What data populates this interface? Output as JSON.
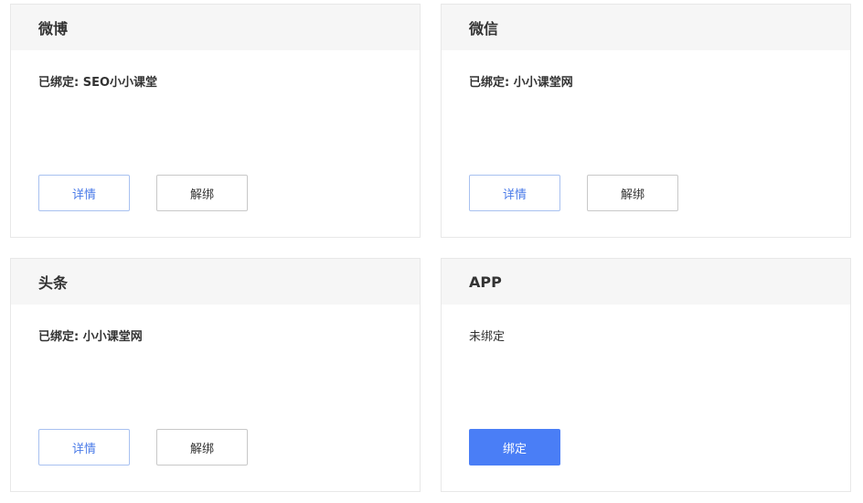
{
  "cards": [
    {
      "title": "微博",
      "status": "已绑定: SEO小小课堂",
      "detail_label": "详情",
      "unbind_label": "解绑"
    },
    {
      "title": "微信",
      "status": "已绑定: 小小课堂网",
      "detail_label": "详情",
      "unbind_label": "解绑"
    },
    {
      "title": "头条",
      "status": "已绑定: 小小课堂网",
      "detail_label": "详情",
      "unbind_label": "解绑"
    },
    {
      "title": "APP",
      "status": "未绑定",
      "bind_label": "绑定"
    }
  ],
  "colors": {
    "accent": "#4a7ef6",
    "detail_text": "#4a7be8",
    "header_bg": "#f6f6f6",
    "border": "#e8e8e8"
  }
}
